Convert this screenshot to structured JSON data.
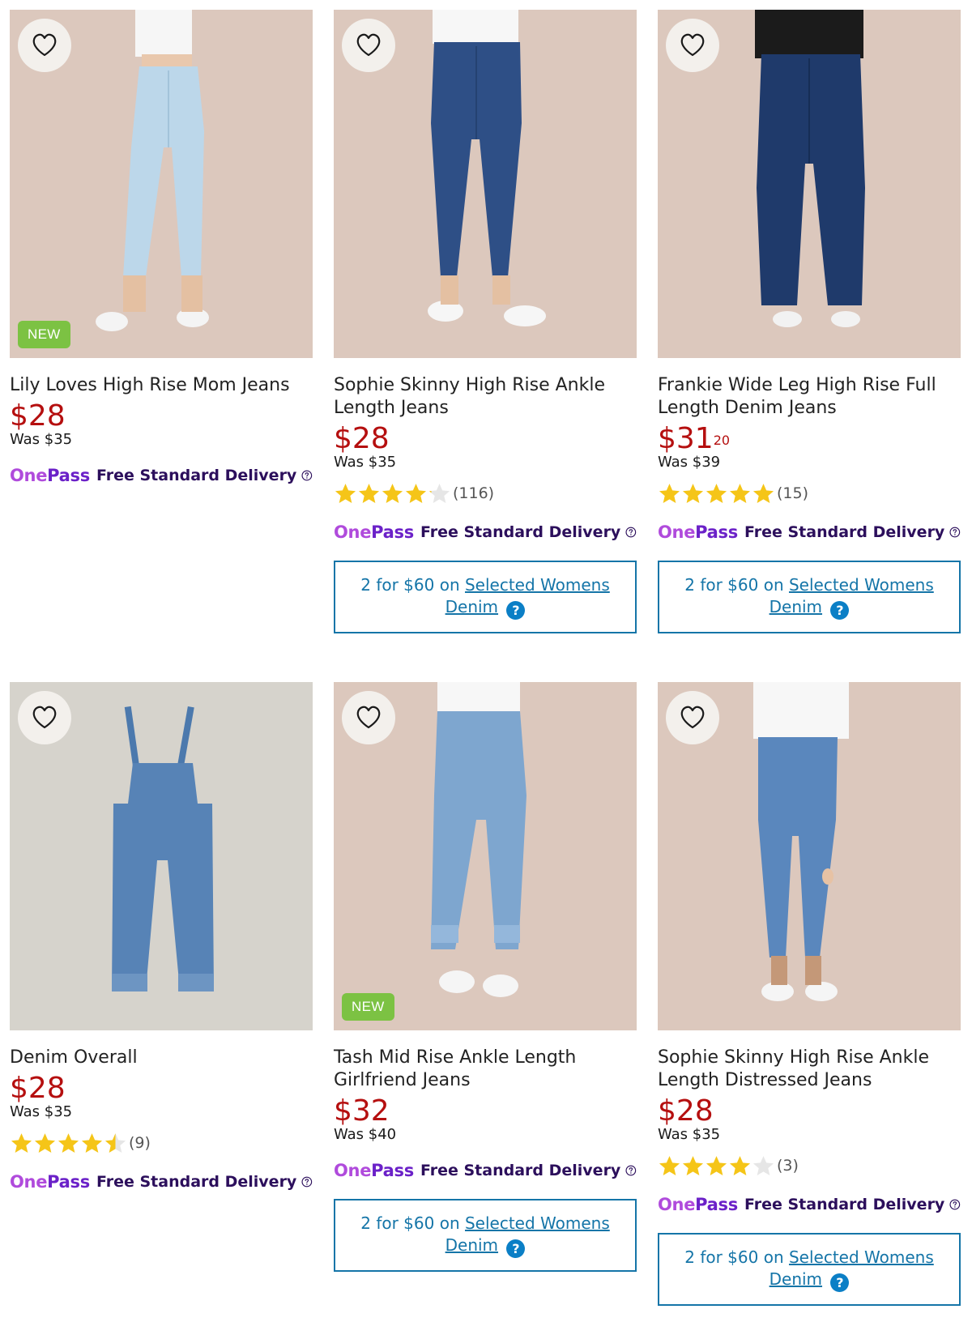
{
  "delivery_label": "Free Standard Delivery",
  "onepass_brand": {
    "one": "One",
    "pass": "Pass"
  },
  "promo": {
    "prefix": "2 for $60 on",
    "link_line1": "Selected Womens",
    "link_line2": "Denim",
    "help": "?"
  },
  "new_badge": "NEW",
  "colors": {
    "price": "#b50f0f",
    "promo": "#1575a8",
    "onepass": "#6b21c8",
    "new_badge": "#7cc243",
    "star": "#f5c518"
  },
  "products": [
    {
      "title_l1": "Lily Loves High Rise Mom Jeans",
      "title_l2": "",
      "price_main": "$28",
      "price_cents": "",
      "was": "Was $35",
      "is_new": true,
      "rating": null,
      "rating_count": "",
      "promo": false,
      "image": "light-wash-mom-jeans"
    },
    {
      "title_l1": "Sophie Skinny High Rise Ankle",
      "title_l2": "Length Jeans",
      "price_main": "$28",
      "price_cents": "",
      "was": "Was $35",
      "is_new": false,
      "rating": 4.1,
      "rating_count": "(116)",
      "promo": true,
      "image": "dark-skinny-jeans"
    },
    {
      "title_l1": "Frankie Wide Leg High Rise Full",
      "title_l2": "Length Denim Jeans",
      "price_main": "$31",
      "price_cents": "20",
      "was": "Was $39",
      "is_new": false,
      "rating": 5,
      "rating_count": "(15)",
      "promo": true,
      "image": "dark-wide-leg-jeans"
    },
    {
      "title_l1": "Denim Overall",
      "title_l2": "",
      "price_main": "$28",
      "price_cents": "",
      "was": "Was $35",
      "is_new": false,
      "rating": 4.5,
      "rating_count": "(9)",
      "promo": false,
      "image": "denim-overall"
    },
    {
      "title_l1": "Tash Mid Rise Ankle Length",
      "title_l2": "Girlfriend Jeans",
      "price_main": "$32",
      "price_cents": "",
      "was": "Was $40",
      "is_new": true,
      "rating": null,
      "rating_count": "",
      "promo": true,
      "image": "girlfriend-jeans"
    },
    {
      "title_l1": "Sophie Skinny High Rise Ankle",
      "title_l2": "Length Distressed Jeans",
      "price_main": "$28",
      "price_cents": "",
      "was": "Was $35",
      "is_new": false,
      "rating": 4,
      "rating_count": "(3)",
      "promo": true,
      "image": "distressed-skinny-jeans"
    }
  ]
}
